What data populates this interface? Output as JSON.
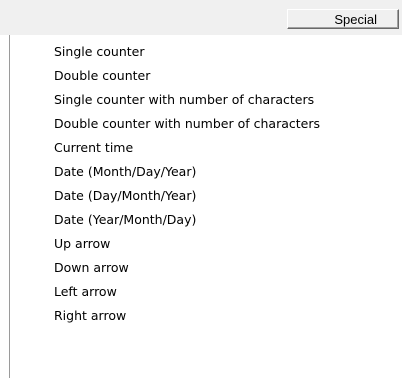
{
  "menu": {
    "button_label": "Special",
    "items": [
      "Single counter",
      "Double counter",
      "Single counter with number of characters",
      "Double counter with number of characters",
      "Current time",
      "Date (Month/Day/Year)",
      "Date (Day/Month/Year)",
      "Date (Year/Month/Day)",
      "Up arrow",
      "Down arrow",
      "Left arrow",
      "Right arrow"
    ]
  }
}
